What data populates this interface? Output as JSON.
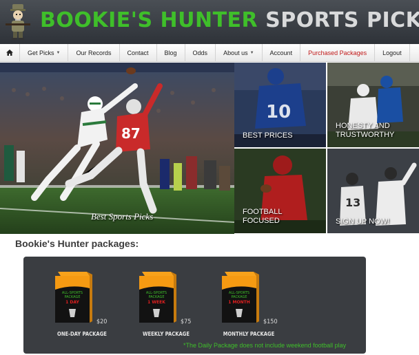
{
  "brand": {
    "part1": "BOOKIE'S HUNTER",
    "part2": "SPORTS PICKS",
    "green": "#3fbf2a",
    "grey": "#d9dadb"
  },
  "nav": {
    "home_icon": "home-icon",
    "items": [
      {
        "label": "Get Picks",
        "dropdown": true
      },
      {
        "label": "Our Records",
        "dropdown": false
      },
      {
        "label": "Contact",
        "dropdown": false
      },
      {
        "label": "Blog",
        "dropdown": false
      },
      {
        "label": "Odds",
        "dropdown": false
      },
      {
        "label": "About us",
        "dropdown": true
      },
      {
        "label": "Account",
        "dropdown": false
      },
      {
        "label": "Purchased Packages",
        "dropdown": false,
        "color": "#c01919"
      },
      {
        "label": "Logout",
        "dropdown": false
      }
    ]
  },
  "hero": {
    "caption": "Best Sports Picks"
  },
  "tiles": [
    {
      "label": "BEST PRICES"
    },
    {
      "label": "HONESTY AND\nTRUSTWORTHY"
    },
    {
      "label": "FOOTBALL\nFOCUSED"
    },
    {
      "label": "SIGN UP NOW!"
    }
  ],
  "packages": {
    "heading": "Bookie's Hunter packages:",
    "items": [
      {
        "box_title": "ALL-SPORTS\nPACKAGE",
        "duration": "1 DAY",
        "price": "$20",
        "name": "ONE-DAY PACKAGE"
      },
      {
        "box_title": "ALL-SPORTS\nPACKAGE",
        "duration": "1 WEEK",
        "price": "$75",
        "name": "WEEKLY PACKAGE"
      },
      {
        "box_title": "ALL-SPORTS\nPACKAGE",
        "duration": "1 MONTH",
        "price": "$150",
        "name": "MONTHLY PACKAGE"
      }
    ],
    "note": "*The Daily Package does not include weekend football play"
  }
}
